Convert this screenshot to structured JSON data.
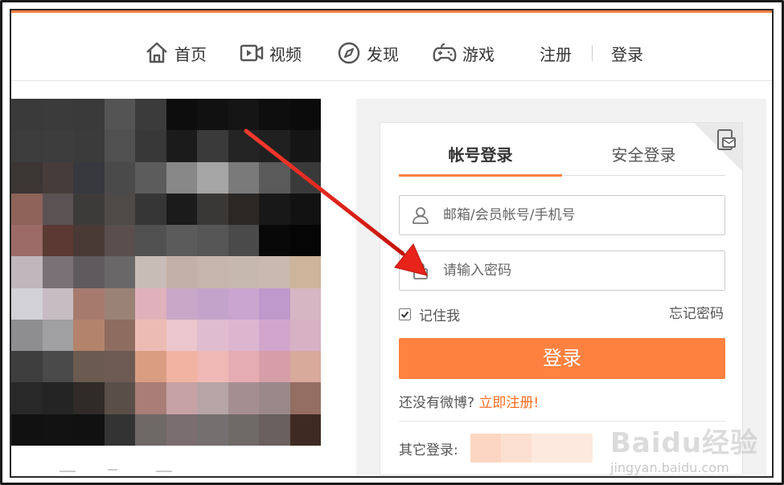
{
  "nav": {
    "items": [
      {
        "label": "首页",
        "icon": "home-icon"
      },
      {
        "label": "视频",
        "icon": "video-icon"
      },
      {
        "label": "发现",
        "icon": "compass-icon"
      },
      {
        "label": "游戏",
        "icon": "gamepad-icon"
      }
    ],
    "register": "注册",
    "login": "登录"
  },
  "login": {
    "tab_account": "帐号登录",
    "tab_secure": "安全登录",
    "username_placeholder": "邮箱/会员帐号/手机号",
    "password_placeholder": "请输入密码",
    "remember_label": "记住我",
    "remember_checked": true,
    "forgot_label": "忘记密码",
    "submit_label": "登录",
    "no_account_text": "还没有微博?",
    "register_link": "立即注册!",
    "other_login_label": "其它登录:"
  },
  "watermark": {
    "brand": "Baidu经验",
    "url": "jingyan.baidu.com"
  },
  "colors": {
    "accent": "#ff8140",
    "link": "#ff6b20",
    "arrow": "#e8231a"
  }
}
